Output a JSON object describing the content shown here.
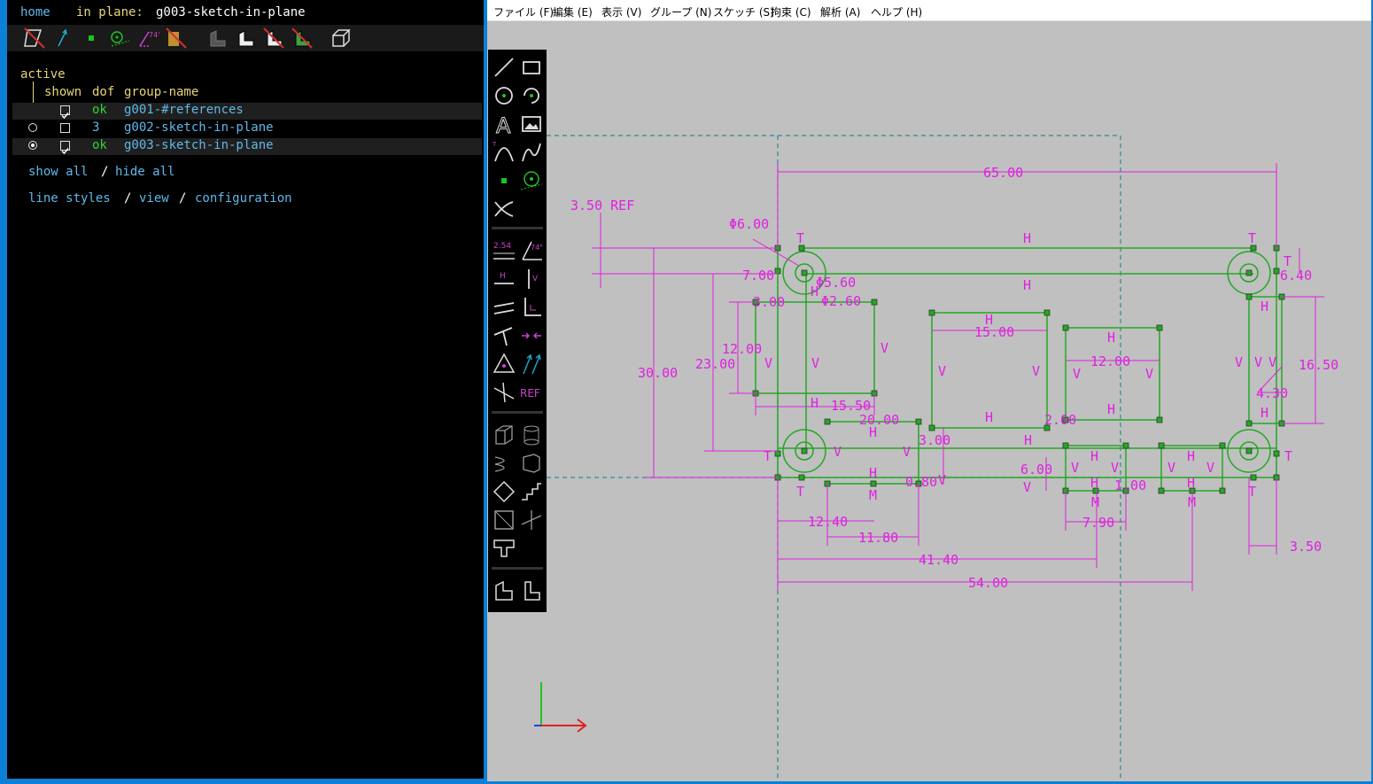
{
  "nav": {
    "home": "home",
    "in_plane_label": "in plane:",
    "in_plane_value": "g003-sketch-in-plane"
  },
  "groups_header": {
    "active": "active",
    "shown": "shown",
    "dof": "dof",
    "group_name": "group-name"
  },
  "groups": [
    {
      "dof": "ok",
      "name": "g001-#references",
      "shown": true,
      "active": false
    },
    {
      "dof": "3",
      "name": "g002-sketch-in-plane",
      "shown": false,
      "active": false
    },
    {
      "dof": "ok",
      "name": "g003-sketch-in-plane",
      "shown": true,
      "active": true
    }
  ],
  "links": {
    "show_all": "show all",
    "sep1": "/",
    "hide_all": "hide all",
    "line_styles": "line styles",
    "sep2": "/",
    "view": "view",
    "sep3": "/",
    "configuration": "configuration"
  },
  "menus": [
    "ファイル (F)",
    "編集 (E)",
    "表示 (V)",
    "グループ (N)",
    "スケッチ (S)",
    "拘束 (C)",
    "解析 (A)",
    "ヘルプ (H)"
  ],
  "tool_labels": {
    "dimension": "2.54",
    "angle": "74°",
    "ref": "REF"
  },
  "dims": [
    "65.00",
    "3.50 REF",
    "Φ6.00",
    "7.00",
    "Φ5.60",
    "Φ2.60",
    "6.40",
    "3.00",
    "12.00",
    "V",
    "15.00",
    "12.00",
    "16.50",
    "30.00",
    "23.00",
    "4.30",
    "15.50",
    "20.00",
    "2.60",
    "3.00",
    "6.00",
    "0.80",
    "1.00",
    "12.40",
    "11.80",
    "7.90",
    "3.50",
    "41.40",
    "54.00",
    "H",
    "T",
    "M"
  ],
  "colors": {
    "magenta": "#e020e0",
    "green": "#20b020",
    "bg": "#c0c0c0",
    "teal": "#3a8a8a"
  }
}
